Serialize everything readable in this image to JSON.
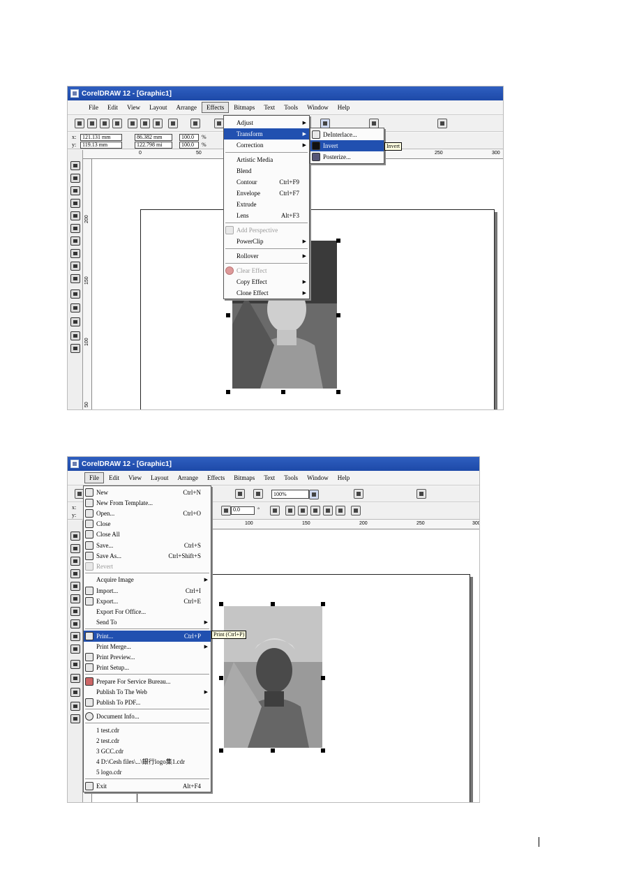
{
  "screenshot1": {
    "title": "CorelDRAW 12 - [Graphic1]",
    "menu": [
      "File",
      "Edit",
      "View",
      "Layout",
      "Arrange",
      "Effects",
      "Bitmaps",
      "Text",
      "Tools",
      "Window",
      "Help"
    ],
    "active_menu": "Effects",
    "props": {
      "x": "121.131 mm",
      "y": "119.13 mm",
      "w": "86.382 mm",
      "h": "122.798 mi",
      "sx": "100.0",
      "sy": "100.0",
      "pct": "%"
    },
    "ruler_h": [
      "0",
      "50",
      "250",
      "300"
    ],
    "ruler_v": [
      "200",
      "150",
      "100",
      "50"
    ],
    "effects_menu": [
      {
        "label": "Adjust",
        "arrow": "▶"
      },
      {
        "label": "Transform",
        "arrow": "▶",
        "selected": true
      },
      {
        "label": "Correction",
        "arrow": "▶"
      },
      {
        "label": "Artistic Media"
      },
      {
        "label": "Blend"
      },
      {
        "label": "Contour",
        "shortcut": "Ctrl+F9"
      },
      {
        "label": "Envelope",
        "shortcut": "Ctrl+F7"
      },
      {
        "label": "Extrude"
      },
      {
        "label": "Lens",
        "shortcut": "Alt+F3"
      },
      {
        "label": "Add Perspective",
        "disabled": true
      },
      {
        "label": "PowerClip",
        "arrow": "▶"
      },
      {
        "label": "Rollover",
        "arrow": "▶"
      },
      {
        "label": "Clear Effect",
        "disabled": true
      },
      {
        "label": "Copy Effect",
        "arrow": "▶"
      },
      {
        "label": "Clone Effect",
        "arrow": "▶"
      }
    ],
    "transform_submenu": [
      {
        "label": "DeInterlace..."
      },
      {
        "label": "Invert",
        "selected": true
      },
      {
        "label": "Posterize..."
      }
    ],
    "tooltip": "Invert"
  },
  "screenshot2": {
    "title": "CorelDRAW 12 - [Graphic1]",
    "menu": [
      "File",
      "Edit",
      "View",
      "Layout",
      "Arrange",
      "Effects",
      "Bitmaps",
      "Text",
      "Tools",
      "Window",
      "Help"
    ],
    "active_menu": "File",
    "zoom": "100%",
    "rotation": "0.0",
    "degree": "°",
    "ruler_h": [
      "100",
      "150",
      "200",
      "250",
      "300"
    ],
    "file_menu": [
      {
        "label": "New",
        "shortcut": "Ctrl+N"
      },
      {
        "label": "New From Template..."
      },
      {
        "label": "Open...",
        "shortcut": "Ctrl+O"
      },
      {
        "label": "Close"
      },
      {
        "label": "Close All"
      },
      {
        "label": "Save...",
        "shortcut": "Ctrl+S"
      },
      {
        "label": "Save As...",
        "shortcut": "Ctrl+Shift+S"
      },
      {
        "label": "Revert",
        "disabled": true
      },
      {
        "label": "Acquire Image",
        "arrow": "▶"
      },
      {
        "label": "Import...",
        "shortcut": "Ctrl+I"
      },
      {
        "label": "Export...",
        "shortcut": "Ctrl+E"
      },
      {
        "label": "Export For Office..."
      },
      {
        "label": "Send To",
        "arrow": "▶"
      },
      {
        "label": "Print...",
        "shortcut": "Ctrl+P",
        "selected": true
      },
      {
        "label": "Print Merge...",
        "arrow": "▶"
      },
      {
        "label": "Print Preview..."
      },
      {
        "label": "Print Setup..."
      },
      {
        "label": "Prepare For Service Bureau..."
      },
      {
        "label": "Publish To The Web",
        "arrow": "▶"
      },
      {
        "label": "Publish To PDF..."
      },
      {
        "label": "Document Info..."
      },
      {
        "label": "1 test.cdr"
      },
      {
        "label": "2 test.cdr"
      },
      {
        "label": "3 GCC.cdr"
      },
      {
        "label": "4 D:\\Cesh files\\...\\銀行logo集1.cdr"
      },
      {
        "label": "5 logo.cdr"
      },
      {
        "label": "Exit",
        "shortcut": "Alt+F4"
      }
    ],
    "tooltip": "Print (Ctrl+P)"
  }
}
